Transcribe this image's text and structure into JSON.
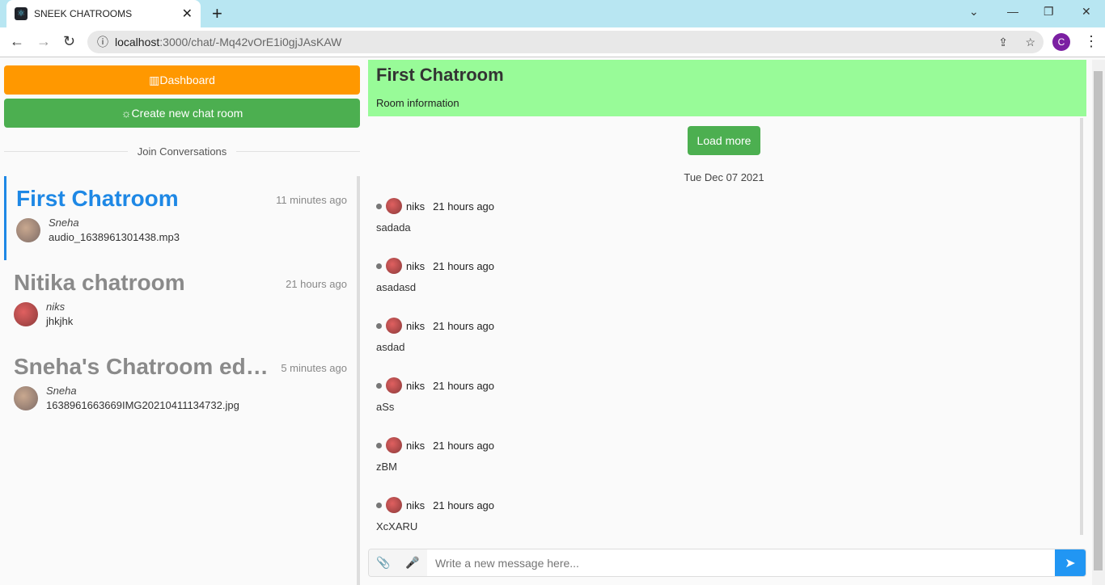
{
  "browser": {
    "tab_title": "SNEEK CHATROOMS",
    "url_host": "localhost",
    "url_path": ":3000/chat/-Mq42vOrE1i0gjJAsKAW",
    "profile": "C"
  },
  "sidebar": {
    "dashboard": "Dashboard",
    "create": "Create new chat room",
    "join": "Join Conversations",
    "rooms": [
      {
        "name": "First Chatroom",
        "time": "11 minutes ago",
        "author": "Sneha",
        "last": "audio_1638961301438.mp3"
      },
      {
        "name": "Nitika chatroom",
        "time": "21 hours ago",
        "author": "niks",
        "last": "jhkjhk"
      },
      {
        "name": "Sneha's Chatroom edited",
        "time": "5 minutes ago",
        "author": "Sneha",
        "last": "1638961663669IMG20210411134732.jpg"
      }
    ]
  },
  "chat": {
    "title": "First Chatroom",
    "info": "Room information",
    "load_more": "Load more",
    "date": "Tue Dec 07 2021",
    "messages": [
      {
        "author": "niks",
        "time": "21 hours ago",
        "text": "sadada"
      },
      {
        "author": "niks",
        "time": "21 hours ago",
        "text": "asadasd"
      },
      {
        "author": "niks",
        "time": "21 hours ago",
        "text": "asdad"
      },
      {
        "author": "niks",
        "time": "21 hours ago",
        "text": "aSs"
      },
      {
        "author": "niks",
        "time": "21 hours ago",
        "text": "zBM"
      },
      {
        "author": "niks",
        "time": "21 hours ago",
        "text": "XcXARU"
      }
    ],
    "placeholder": "Write a new message here..."
  }
}
